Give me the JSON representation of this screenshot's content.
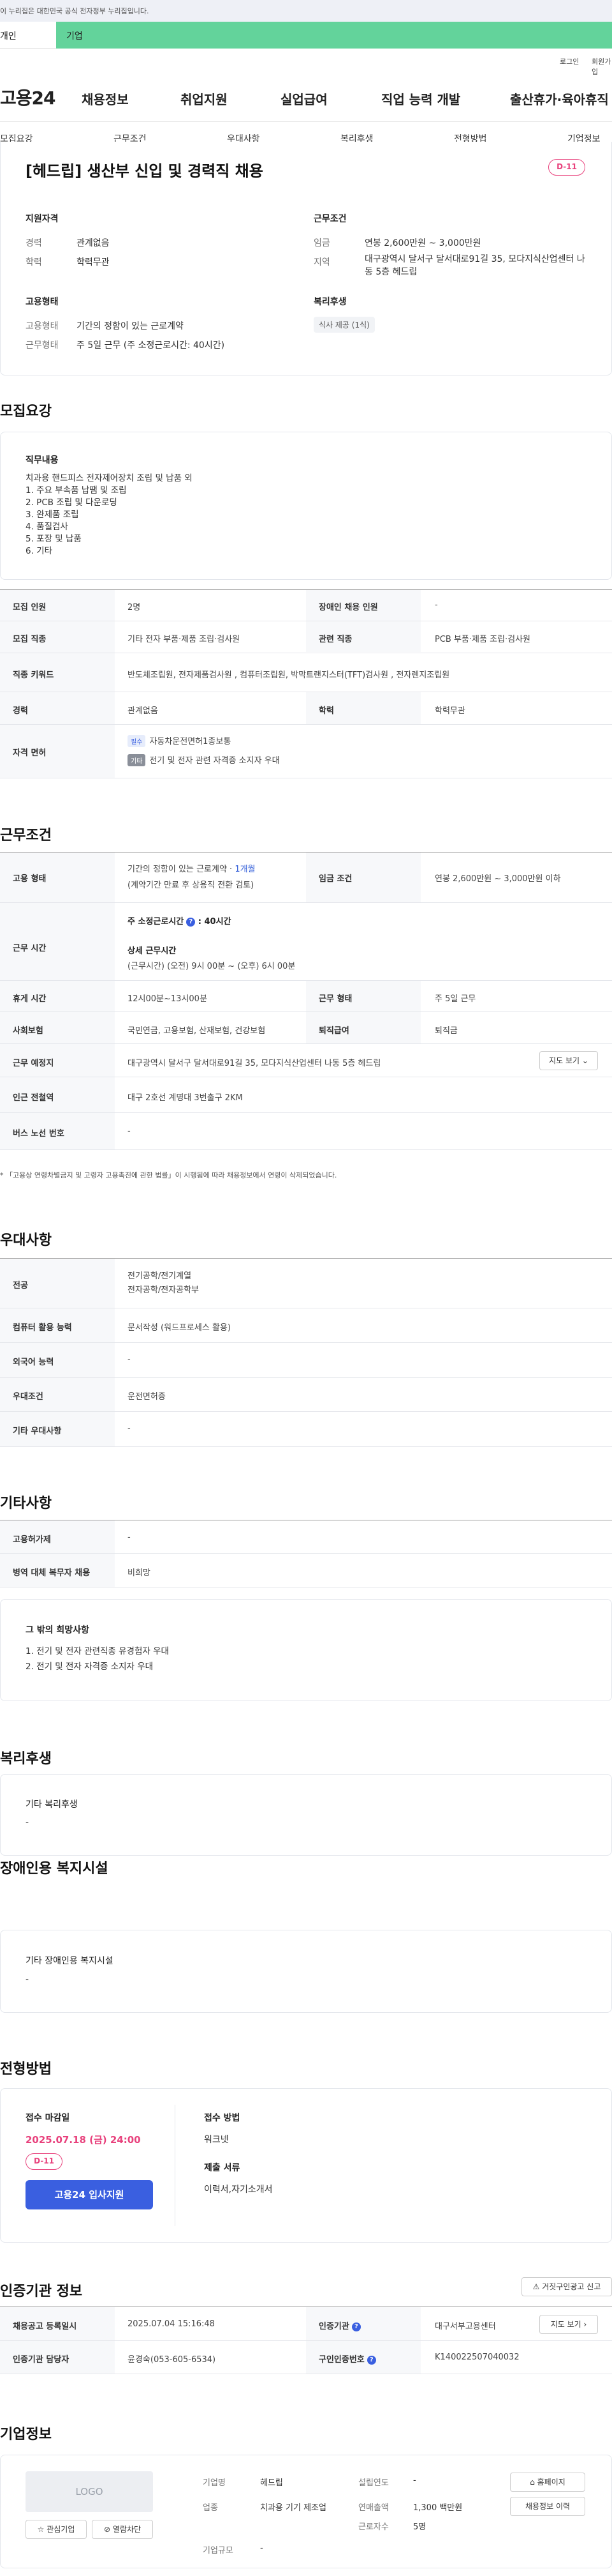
{
  "gov_banner": "이 누리집은 대한민국 공식 전자정부 누리집입니다.",
  "tabs": {
    "personal": "개인",
    "company": "기업"
  },
  "util": {
    "login": "로그인",
    "signup": "회원가입"
  },
  "logo": "고용24",
  "gnb": [
    "채용정보",
    "취업지원",
    "실업급여",
    "직업 능력 개발",
    "출산휴가·육아휴직"
  ],
  "subnav": [
    "모집요강",
    "근무조건",
    "우대사항",
    "복리후생",
    "전형방법",
    "기업정보"
  ],
  "summary": {
    "title": "[헤드립] 생산부 신입 및 경력직 채용",
    "dday": "D-11",
    "qualification_title": "지원자격",
    "career_label": "경력",
    "career_value": "관계없음",
    "education_label": "학력",
    "education_value": "학력무관",
    "employment_title": "고용형태",
    "emp_type_label": "고용형태",
    "emp_type_value": "기간의 정함이 있는 근로계약",
    "work_type_label": "근무형태",
    "work_type_value": "주 5일 근무 (주 소정근로시간: 40시간)",
    "conditions_title": "근무조건",
    "wage_label": "임금",
    "wage_value": "연봉 2,600만원 ~ 3,000만원",
    "region_label": "지역",
    "region_value": "대구광역시 달서구 달서대로91길 35, 모다지식산업센터 나동 5층 헤드립",
    "welfare_title": "복리후생",
    "welfare_chip": "식사 제공 (1식)"
  },
  "recruit": {
    "section_title": "모집요강",
    "duty_title": "직무내용",
    "duty_lines": [
      "치과용 핸드피스 전자제어장치 조립 및 납품 외",
      "1. 주요 부속품 납땜 및 조립",
      "2. PCB 조립 및 다운로딩",
      "3. 완제품 조립",
      "4. 품질검사",
      "5. 포장 및 납품",
      "6. 기타"
    ],
    "rows": [
      {
        "l1": "모집 인원",
        "v1": "2명",
        "l2": "장애인 채용 인원",
        "v2": "-"
      },
      {
        "l1": "모집 직종",
        "v1": "기타 전자 부품·제품 조립·검사원",
        "l2": "관련 직종",
        "v2": "PCB 부품·제품 조립·검사원"
      },
      {
        "l1": "직종 키워드",
        "v1": "반도체조립원, 전자제품검사원 , 컴퓨터조립원, 박막트랜지스터(TFT)검사원 , 전자렌지조립원"
      },
      {
        "l1": "경력",
        "v1": "관계없음",
        "l2": "학력",
        "v2": "학력무관"
      }
    ],
    "license_label": "자격 면허",
    "license_tag1": "필수",
    "license_1": "자동차운전면허1종보통",
    "license_tag2": "기타",
    "license_2": "전기 및 전자 관련 자격증 소지자 우대"
  },
  "conditions": {
    "section_title": "근무조건",
    "emp_label": "고용 형태",
    "emp_value": "기간의 정함이 있는 근로계약 · ",
    "emp_period": "1개월",
    "emp_note": "(계약기간 만료 후 상용직 전환 검토)",
    "wage_label": "임금 조건",
    "wage_value": "연봉 2,600만원 ~ 3,000만원 이하",
    "hours_label": "근무 시간",
    "hours_main": "주 소정근로시간",
    "hours_value": ": 40시간",
    "hours_detail_title": "상세 근무시간",
    "hours_detail": "(근무시간) (오전) 9시 00분 ~ (오후) 6시 00분",
    "break_label": "휴게 시간",
    "break_value": "12시00분~13시00분",
    "worktype_label": "근무 형태",
    "worktype_value": "주 5일 근무",
    "insurance_label": "사회보험",
    "insurance_value": "국민연금, 고용보험, 산재보험, 건강보험",
    "severance_label": "퇴직급여",
    "severance_value": "퇴직금",
    "location_label": "근무 예정지",
    "location_value": "대구광역시 달서구 달서대로91길 35, 모다지식산업센터 나동 5층 헤드립",
    "map_button": "지도 보기",
    "station_label": "인근 전철역",
    "station_value": "대구 2호선 계명대 3번출구 2KM",
    "bus_label": "버스 노선 번호",
    "bus_value": "-",
    "footnote": "* 「고용상 연령차별금지 및 고령자 고용촉진에 관한 법률」이 시행됨에 따라 채용정보에서 연령이 삭제되었습니다."
  },
  "preference": {
    "section_title": "우대사항",
    "major_label": "전공",
    "major_lines": [
      "전기공학/전기계열",
      "전자공학/전자공학부"
    ],
    "computer_label": "컴퓨터 활용 능력",
    "computer_value": "문서작성 (워드프로세스 활용)",
    "language_label": "외국어 능력",
    "language_value": "-",
    "pref_label": "우대조건",
    "pref_value": "운전면허증",
    "other_label": "기타 우대사항",
    "other_value": "-"
  },
  "other": {
    "section_title": "기타사항",
    "dispatch_label": "고용허가제",
    "dispatch_value": "-",
    "military_label": "병역 대체 복무자 채용",
    "military_value": "비희망",
    "wish_title": "그 밖의 희망사항",
    "wish_lines": [
      "1. 전기 및 전자 관련직종 유경험자 우대",
      "2. 전기 및 전자 자격증 소지자 우대"
    ]
  },
  "welfare": {
    "section_title": "복리후생",
    "box_title": "기타 복리후생",
    "box_value": "-"
  },
  "disabled": {
    "section_title": "장애인용 복지시설",
    "box_title": "기타 장애인용 복지시설",
    "box_value": "-"
  },
  "screening": {
    "section_title": "전형방법",
    "deadline_title": "접수 마감일",
    "deadline": "2025.07.18 (금) 24:00",
    "dday": "D-11",
    "apply_button": "고용24 입사지원",
    "method_title": "접수 방법",
    "method_value": "워크넷",
    "docs_title": "제출 서류",
    "docs_value": "이력서,자기소개서"
  },
  "cert": {
    "section_title": "인증기관 정보",
    "report_button": "거짓구인광고 신고",
    "reg_date_label": "채용공고 등록일시",
    "reg_date_value": "2025.07.04 15:16:48",
    "agency_label": "인증기관",
    "agency_value": "대구서부고용센터",
    "map_button": "지도 보기",
    "manager_label": "인증기관 담당자",
    "manager_value": "윤경숙(053-605-6534)",
    "reqno_label": "구인인증번호",
    "reqno_value": "K140022507040032"
  },
  "company": {
    "section_title": "기업정보",
    "logo_text": "LOGO",
    "interest_button": "관심기업",
    "block_button": "열람차단",
    "name_label": "기업명",
    "name_value": "헤드립",
    "industry_label": "업종",
    "industry_value": "치과용 기기 제조업",
    "size_label": "기업규모",
    "size_value": "-",
    "founded_label": "설립연도",
    "founded_value": "-",
    "sales_label": "연매출액",
    "sales_value": "1,300 백만원",
    "employees_label": "근로자수",
    "employees_value": "5명",
    "homepage_button": "홈페이지",
    "jobs_button": "채용정보 이력"
  }
}
